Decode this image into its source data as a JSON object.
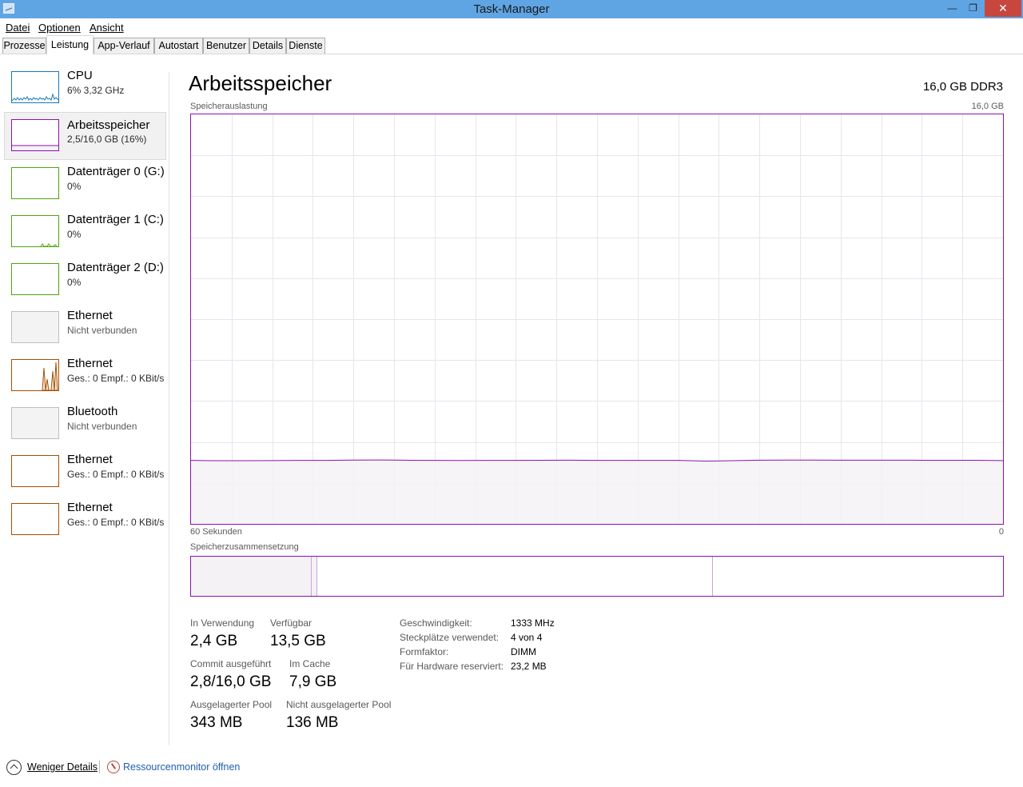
{
  "window": {
    "title": "Task-Manager",
    "minimize_glyph": "—",
    "restore_glyph": "❐",
    "close_glyph": "✕"
  },
  "menu": [
    {
      "label": "Datei"
    },
    {
      "label": "Optionen"
    },
    {
      "label": "Ansicht"
    }
  ],
  "tabs": [
    {
      "label": "Prozesse"
    },
    {
      "label": "Leistung",
      "active": true
    },
    {
      "label": "App-Verlauf"
    },
    {
      "label": "Autostart"
    },
    {
      "label": "Benutzer"
    },
    {
      "label": "Details"
    },
    {
      "label": "Dienste"
    }
  ],
  "sidebar": [
    {
      "name": "CPU",
      "sub": "6%  3,32 GHz",
      "color": "#1779ba",
      "icon": "cpu-graph-icon"
    },
    {
      "name": "Arbeitsspeicher",
      "sub": "2,5/16,0 GB (16%)",
      "color": "#8b12ae",
      "icon": "memory-graph-icon",
      "selected": true
    },
    {
      "name": "Datenträger 0 (G:)",
      "sub": "0%",
      "color": "#4da60c",
      "icon": "disk-graph-icon"
    },
    {
      "name": "Datenträger 1 (C:)",
      "sub": "0%",
      "color": "#4da60c",
      "icon": "disk-graph-icon"
    },
    {
      "name": "Datenträger 2 (D:)",
      "sub": "0%",
      "color": "#4da60c",
      "icon": "disk-graph-icon"
    },
    {
      "name": "Ethernet",
      "sub": "Nicht verbunden",
      "color": "#bfbfbf",
      "icon": "network-graph-icon"
    },
    {
      "name": "Ethernet",
      "sub": "Ges.: 0  Empf.: 0 KBit/s",
      "color": "#a74f01",
      "icon": "network-graph-icon"
    },
    {
      "name": "Bluetooth",
      "sub": "Nicht verbunden",
      "color": "#bfbfbf",
      "icon": "bluetooth-graph-icon"
    },
    {
      "name": "Ethernet",
      "sub": "Ges.: 0  Empf.: 0 KBit/s",
      "color": "#a74f01",
      "icon": "network-graph-icon"
    },
    {
      "name": "Ethernet",
      "sub": "Ges.: 0  Empf.: 0 KBit/s",
      "color": "#a74f01",
      "icon": "network-graph-icon"
    }
  ],
  "main": {
    "title": "Arbeitsspeicher",
    "spec": "16,0 GB DDR3",
    "usage_label": "Speicherauslastung",
    "usage_max": "16,0 GB",
    "time_left": "60 Sekunden",
    "time_right": "0",
    "composition_label": "Speicherzusammensetzung",
    "accent_color": "#8b12ae",
    "fill_color": "#f4f2f5"
  },
  "memory_usage": {
    "usage_fraction": 0.155,
    "composition": {
      "in_use_fraction": 0.149,
      "modified_fraction": 0.007,
      "standby_fraction": 0.487,
      "free_fraction": 0.357
    }
  },
  "stats": {
    "in_use": {
      "label": "In Verwendung",
      "value": "2,4 GB"
    },
    "available": {
      "label": "Verfügbar",
      "value": "13,5 GB"
    },
    "committed": {
      "label": "Commit ausgeführt",
      "value": "2,8/16,0 GB"
    },
    "cached": {
      "label": "Im Cache",
      "value": "7,9 GB"
    },
    "paged_pool": {
      "label": "Ausgelagerter Pool",
      "value": "343 MB"
    },
    "nonpaged_pool": {
      "label": "Nicht ausgelagerter Pool",
      "value": "136 MB"
    }
  },
  "details": [
    {
      "key": "Geschwindigkeit:",
      "value": "1333 MHz"
    },
    {
      "key": "Steckplätze verwendet:",
      "value": "4 von 4"
    },
    {
      "key": "Formfaktor:",
      "value": "DIMM"
    },
    {
      "key": "Für Hardware reserviert:",
      "value": "23,2 MB"
    }
  ],
  "footer": {
    "less_details": "Weniger Details",
    "resource_monitor": "Ressourcenmonitor öffnen"
  }
}
